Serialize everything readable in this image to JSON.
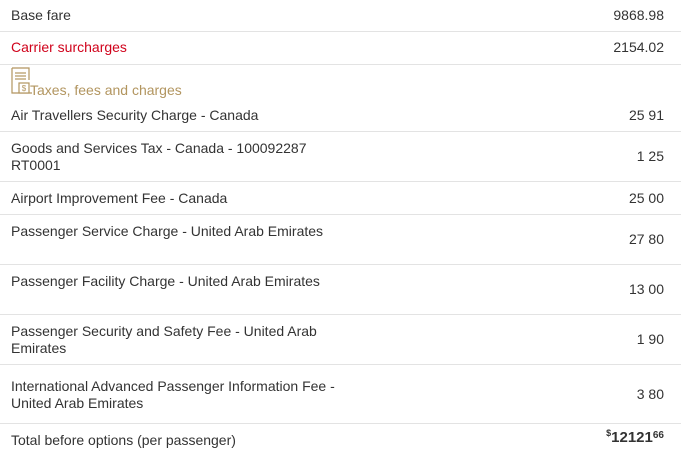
{
  "base_fare": {
    "label": "Base fare",
    "amount": "9868.98"
  },
  "carrier": {
    "label": "Carrier surcharges",
    "amount": "2154.02"
  },
  "taxes": {
    "title": "Taxes, fees and charges",
    "icon": "receipt-dollar-icon",
    "items": [
      {
        "label": "Air Travellers Security Charge - Canada",
        "amount": "25 91"
      },
      {
        "label": "Goods and Services Tax - Canada - 100092287 RT0001",
        "amount": "1 25"
      },
      {
        "label": "Airport Improvement Fee - Canada",
        "amount": "25 00"
      },
      {
        "label": "Passenger Service Charge - United Arab Emirates",
        "amount": "27 80"
      },
      {
        "label": "Passenger Facility Charge - United Arab Emirates",
        "amount": "13 00"
      },
      {
        "label": "Passenger Security and Safety Fee - United Arab Emirates",
        "amount": "1 90"
      },
      {
        "label": "International Advanced Passenger Information Fee - United Arab Emirates",
        "amount": "3 80"
      }
    ]
  },
  "total": {
    "label": "Total before options (per passenger)",
    "currency": "$",
    "whole": "12121",
    "cents": "66"
  },
  "colors": {
    "accent_red": "#d0021b",
    "tax_title": "#b2955f"
  }
}
